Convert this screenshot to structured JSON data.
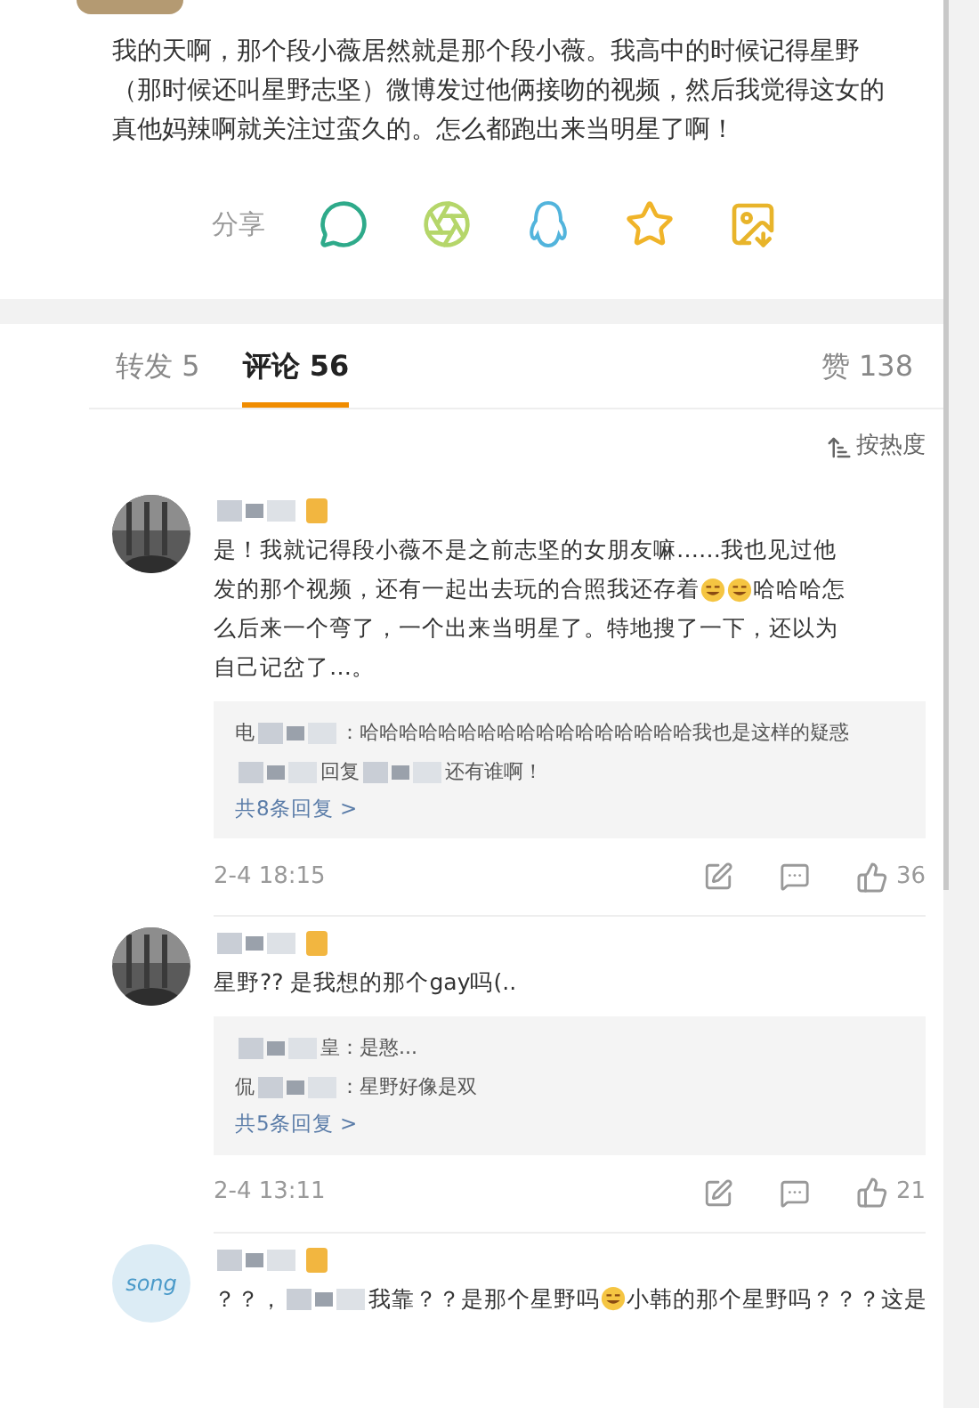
{
  "post": {
    "text": "我的天啊，那个段小薇居然就是那个段小薇。我高中的时候记得星野（那时候还叫星野志坚）微博发过他俩接吻的视频，然后我觉得这女的真他妈辣啊就关注过蛮久的。怎么都跑出来当明星了啊！",
    "share_label": "分享"
  },
  "tabs": [
    {
      "label": "转发 5",
      "selected": false
    },
    {
      "label": "评论 56",
      "selected": true
    }
  ],
  "likes_tab": "赞 138",
  "sort": "按热度",
  "comments": [
    {
      "avatar": {
        "kind": "photo"
      },
      "lines": [
        [
          {
            "kind": "text",
            "text": "是！我就记得段小薇不是之前志坚的女朋友嘛……我也见过他"
          }
        ],
        [
          {
            "kind": "text",
            "text": "发的那个视频，还有一起出去玩的合照我还存着"
          },
          {
            "kind": "emoji"
          },
          {
            "kind": "emoji"
          },
          {
            "kind": "text",
            "text": "哈哈哈怎"
          }
        ],
        [
          {
            "kind": "text",
            "text": "么后来一个弯了，一个出来当明星了。特地搜了一下，还以为"
          }
        ],
        [
          {
            "kind": "text",
            "text": "自己记岔了…。"
          }
        ]
      ],
      "replies": [
        [
          {
            "kind": "text",
            "text": "电"
          },
          {
            "kind": "blur"
          },
          {
            "kind": "text",
            "text": "：哈哈哈哈哈哈哈哈哈哈哈哈哈哈哈哈哈我也是这样的疑惑"
          }
        ],
        [
          {
            "kind": "blur"
          },
          {
            "kind": "text",
            "text": "回复"
          },
          {
            "kind": "blur"
          },
          {
            "kind": "text",
            "text": "还有谁啊！"
          }
        ]
      ],
      "more_replies": "共8条回复 >",
      "time": "2-4 18:15",
      "likes": "36"
    },
    {
      "avatar": {
        "kind": "photo"
      },
      "lines": [
        [
          {
            "kind": "text",
            "text": "星野?? 是我想的那个gay吗(.."
          }
        ]
      ],
      "replies": [
        [
          {
            "kind": "blur"
          },
          {
            "kind": "text",
            "text": "皇：是憨..."
          }
        ],
        [
          {
            "kind": "text",
            "text": "侃"
          },
          {
            "kind": "blur"
          },
          {
            "kind": "text",
            "text": "：星野好像是双"
          }
        ]
      ],
      "more_replies": "共5条回复 >",
      "time": "2-4 13:11",
      "likes": "21"
    },
    {
      "avatar": {
        "kind": "text",
        "text": "song"
      },
      "lines": [
        [
          {
            "kind": "text",
            "text": "？？，"
          },
          {
            "kind": "blur"
          },
          {
            "kind": "text",
            "text": "我靠？？是那个星野吗"
          },
          {
            "kind": "emoji"
          },
          {
            "kind": "text",
            "text": "小韩的那个星野吗？？？这是"
          }
        ]
      ]
    }
  ]
}
